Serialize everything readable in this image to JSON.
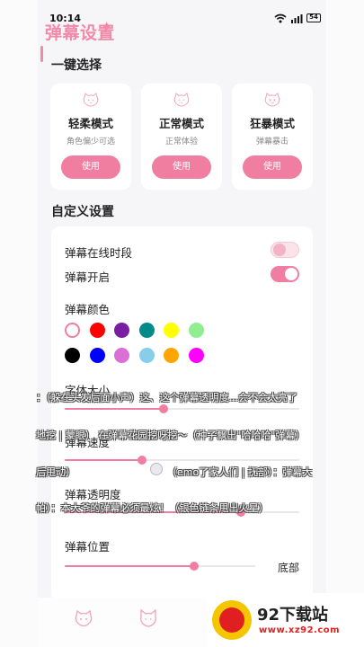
{
  "status_bar": {
    "time": "10:14",
    "battery": "54"
  },
  "app": {
    "title": "弹幕设置"
  },
  "presets": {
    "section_title": "一键选择",
    "cards": [
      {
        "title": "轻柔模式",
        "desc": "角色偏少可选",
        "button": "使用",
        "icon": "cat-face-icon"
      },
      {
        "title": "正常模式",
        "desc": "正常体验",
        "button": "使用",
        "icon": "cat-face-icon"
      },
      {
        "title": "狂暴模式",
        "desc": "弹幕暴击",
        "button": "使用",
        "icon": "angry-cat-face-icon"
      }
    ]
  },
  "custom": {
    "section_title": "自定义设置",
    "online_period": {
      "label": "弹幕在线时段",
      "on": false
    },
    "danmaku_enabled": {
      "label": "弹幕开启",
      "on": true
    },
    "color": {
      "label": "弹幕颜色",
      "selected": "#ffffff",
      "options": [
        "#ffffff",
        "#ff0000",
        "#7b1fa2",
        "#008b8b",
        "#ffff00",
        "#90ee90",
        "#000000",
        "#0000ff",
        "#da70d6",
        "#87ceeb",
        "#ffa500",
        "#ff00ff"
      ]
    },
    "font_size": {
      "label": "字体大小",
      "value": 0.42
    },
    "speed": {
      "label": "弹幕速度",
      "value": 0.33
    },
    "opacity": {
      "label": "弹幕透明度",
      "value": 0.75
    },
    "position": {
      "label": "弹幕位置",
      "value": 0.68,
      "value_label": "底部"
    }
  },
  "danmaku_overlay": [
    "：（躲在头发后面小声）这、这个弹幕透明度...会不会太亮了",
    "地挖 | 蒙眼） 在弹幕花园挖呀挖～（种子飘出\"哈哈哈\"弹幕）",
    "后甩动）",
    "（emo了家人们 | 抚部）：弹幕大",
    "帕）：本大爷的弹幕必须最炫！（银色链条甩出火星）"
  ],
  "bottom_nav": {
    "items": [
      {
        "icon": "cat-face-icon"
      },
      {
        "icon": "cat-head-icon"
      },
      {
        "icon": "mustache-icon"
      }
    ]
  },
  "watermark": {
    "name": "92下载站",
    "url": "www.xz92.com"
  }
}
